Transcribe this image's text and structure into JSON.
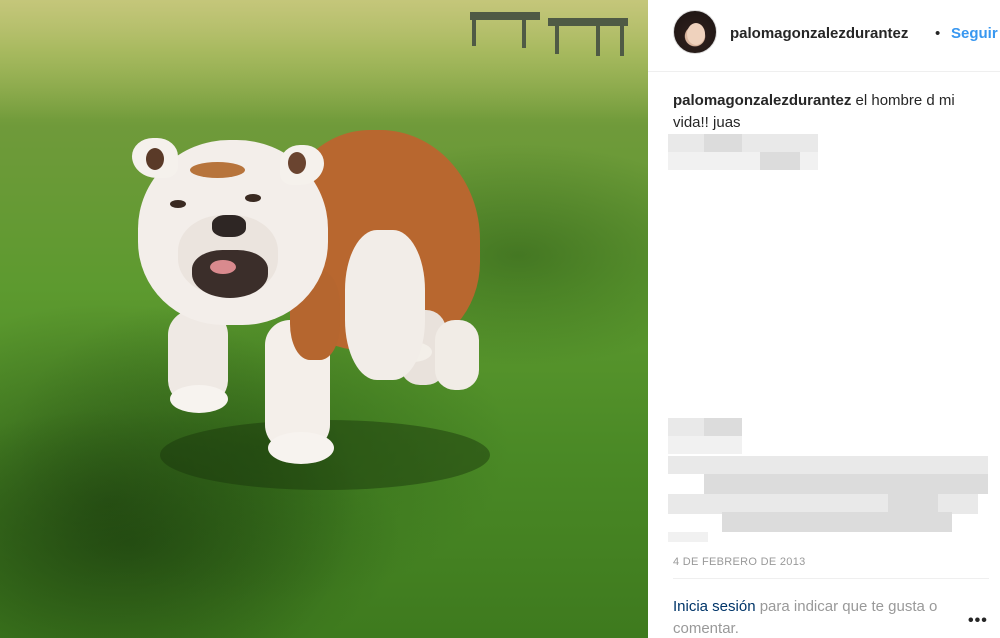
{
  "post": {
    "username": "palomagonzalezdurantez",
    "separator": "•",
    "follow_label": "Seguir",
    "caption_user": "palomagonzalezdurantez",
    "caption_text": " el hombre d mi vida!! juas",
    "date": "4 DE FEBRERO DE 2013",
    "login_link": "Inicia sesión",
    "login_rest": " para indicar que te gusta o comentar.",
    "more_label": "•••",
    "icons": {
      "more": "more-options-icon"
    }
  }
}
